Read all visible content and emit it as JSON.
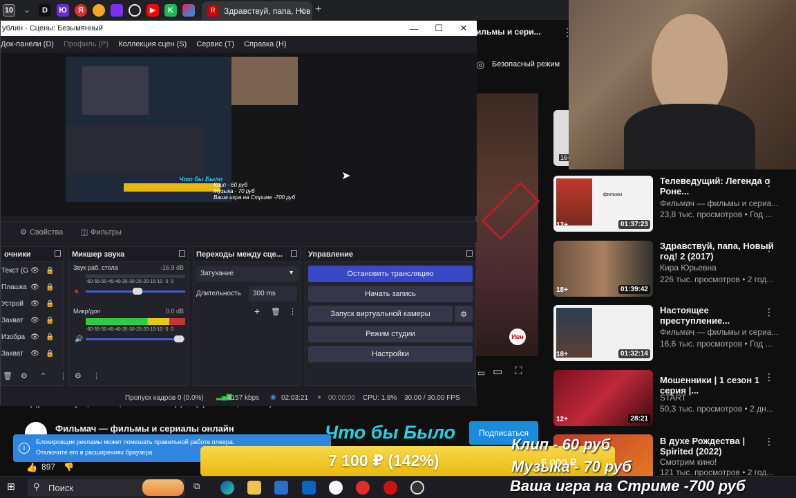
{
  "browser": {
    "tab_title": "Здравствуй, папа, Нов",
    "tab_number": "10",
    "favicon_letter": "R",
    "other_tab_letters": [
      "D",
      "Ю",
      "Я",
      "Ж",
      "K"
    ]
  },
  "obs": {
    "window_title": "ублин - Сцены: Безымянный",
    "menu": [
      "Док-панели (D)",
      "Профиль (P)",
      "Коллекция сцен (S)",
      "Сервис (T)",
      "Справка (H)"
    ],
    "properties_label": "Свойства",
    "filters_label": "Фильтры",
    "sources": {
      "title": "очники",
      "items": [
        "Текст (G",
        "Плашка",
        "Устрой",
        "Захват",
        "Изобра",
        "Захват"
      ]
    },
    "mixer": {
      "title": "Микшер звука",
      "ch1_name": "Звук раб. стола",
      "ch1_db": "-16.9 dB",
      "ch2_name": "Микр/доп",
      "ch2_db": "0.0 dB",
      "scale": "-60-55-50-45-40-35-30-25-20-15-10 -5  0"
    },
    "transitions": {
      "title": "Переходы между сце...",
      "selected": "Затухание",
      "duration_label": "Длительность",
      "duration_value": "300 ms"
    },
    "controls": {
      "title": "Управление",
      "stop_stream": "Остановить трансляцию",
      "start_record": "Начать запись",
      "virtual_cam": "Запуск виртуальной камеры",
      "studio_mode": "Режим студии",
      "settings": "Настройки"
    },
    "status": {
      "dropped": "Пропуск кадров 0 (0.0%)",
      "bitrate": "4157 kbps",
      "stream_time": "02:03:21",
      "record_time": "00:00:00",
      "cpu": "CPU: 1.8%",
      "fps": "30.00 / 30.00 FPS"
    }
  },
  "preview": {
    "overlay_line1": "Что бы Было",
    "overlay_line2": "Клип - 60 руб",
    "overlay_line3": "Музыка - 70 руб",
    "overlay_line4": "Ваша игра на Стриме -700 руб"
  },
  "youtube": {
    "header_fragment": "ильмы и сери...",
    "safe_mode": "Безопасный режим",
    "channel_name": "Фильмач — фильмы и сериалы онлайн",
    "behind_title": "Здравствуй, папа, Новый год 2 (фильм, 2015)",
    "likes": "897",
    "subscribe": "Подписаться",
    "adblock_line1": "Блокировщик рекламы может помешать правильной работе плеера.",
    "adblock_line2": "Отключите его в расширениях браузера",
    "videos": [
      {
        "title": "Телеведущий: Легенда о Роне...",
        "channel": "Фильмач — фильмы и сериа...",
        "meta": "23,8 тыс. просмотров • Год ...",
        "duration": "01:37:23",
        "age": "12+"
      },
      {
        "title": "Здравствуй, папа, Новый год! 2 (2017)",
        "channel": "Кира Юрьевна",
        "meta": "226 тыс. просмотров • 2 год...",
        "duration": "01:39:42",
        "age": "18+"
      },
      {
        "title": "Настоящее преступление...",
        "channel": "Фильмач — фильмы и сериа...",
        "meta": "16,6 тыс. просмотров • Год ...",
        "duration": "01:32:14",
        "age": "18+"
      },
      {
        "title": "Мошенники | 1 сезон 1 серия |...",
        "channel": "START",
        "meta": "50,3 тыс. просмотров • 2 дн...",
        "duration": "28:21",
        "age": "12+"
      },
      {
        "title": "В духе Рождества | Spirited (2022)",
        "channel": "Смотрим кино!",
        "meta": "121 тыс. просмотров • 2 год...",
        "duration": "",
        "age": ""
      }
    ],
    "first_age": "16+"
  },
  "stream_overlay": {
    "title": "Что бы Было",
    "donation": "7 100 ₽ (142%)",
    "goal_fragment": "5 000 ₽",
    "price1": "Клип - 60 руб",
    "price2": "Музыка - 70 руб",
    "price3": "Ваша игра на Стриме -700 руб"
  },
  "taskbar": {
    "search": "Поиск"
  },
  "colors": {
    "obs_stop_button": "#3a48c8",
    "overlay_cyan": "#22d3e0",
    "donation_bar": "#f1c40f",
    "subscribe_blue": "#1a8cdc",
    "adblock_blue": "#2e86de"
  }
}
